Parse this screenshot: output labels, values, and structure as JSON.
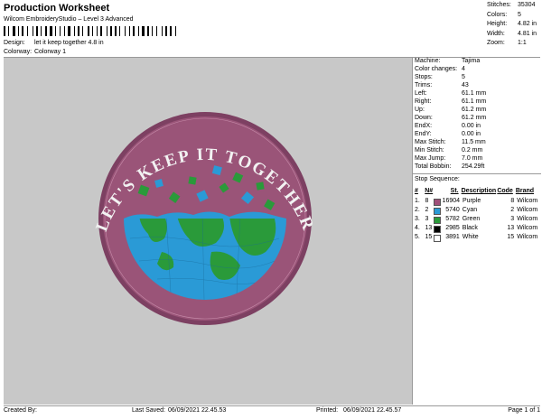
{
  "header": {
    "title": "Production Worksheet",
    "subtitle": "Wilcom EmbroideryStudio – Level 3 Advanced",
    "design_label": "Design:",
    "design_value": "let it keep together 4.8 in",
    "colorway_label": "Colorway:",
    "colorway_value": "Colorway 1"
  },
  "summary": {
    "stitches_label": "Stitches:",
    "stitches_value": "35304",
    "colors_label": "Colors:",
    "colors_value": "5",
    "height_label": "Height:",
    "height_value": "4.82 in",
    "width_label": "Width:",
    "width_value": "4.81 in",
    "zoom_label": "Zoom:",
    "zoom_value": "1:1"
  },
  "machine": {
    "machine_label": "Machine:",
    "machine_value": "Tajima",
    "color_changes_label": "Color changes:",
    "color_changes_value": "4",
    "stops_label": "Stops:",
    "stops_value": "5",
    "trims_label": "Trims:",
    "trims_value": "43",
    "left_label": "Left:",
    "left_value": "61.1 mm",
    "right_label": "Right:",
    "right_value": "61.1 mm",
    "up_label": "Up:",
    "up_value": "61.2 mm",
    "down_label": "Down:",
    "down_value": "61.2 mm",
    "endx_label": "EndX:",
    "endx_value": "0.00 in",
    "endy_label": "EndY:",
    "endy_value": "0.00 in",
    "max_stitch_label": "Max Stitch:",
    "max_stitch_value": "11.5 mm",
    "min_stitch_label": "Min Stitch:",
    "min_stitch_value": "0.2 mm",
    "max_jump_label": "Max Jump:",
    "max_jump_value": "7.0 mm",
    "total_bobbin_label": "Total Bobbin:",
    "total_bobbin_value": "254.29ft"
  },
  "stop_sequence": {
    "title": "Stop Sequence:",
    "headers": {
      "n": "#",
      "num": "N#",
      "st": "St.",
      "desc": "Description",
      "code": "Code",
      "brand": "Brand"
    },
    "rows": [
      {
        "n": "1.",
        "num": "8",
        "color": "#a0507a",
        "st": "16904",
        "desc": "Purple",
        "code": "8",
        "brand": "Wilcom"
      },
      {
        "n": "2.",
        "num": "2",
        "color": "#2a9ad6",
        "st": "5740",
        "desc": "Cyan",
        "code": "2",
        "brand": "Wilcom"
      },
      {
        "n": "3.",
        "num": "3",
        "color": "#2a9a3a",
        "st": "5782",
        "desc": "Green",
        "code": "3",
        "brand": "Wilcom"
      },
      {
        "n": "4.",
        "num": "13",
        "color": "#000000",
        "st": "2985",
        "desc": "Black",
        "code": "13",
        "brand": "Wilcom"
      },
      {
        "n": "5.",
        "num": "15",
        "color": "#ffffff",
        "st": "3891",
        "desc": "White",
        "code": "15",
        "brand": "Wilcom"
      }
    ]
  },
  "design": {
    "arc_text": "LET'S KEEP IT TOGETHER",
    "ring_color": "#8a4a6a",
    "inner_color": "#9a5478",
    "ocean_color": "#2a9ad6",
    "land_color": "#2a9a3a"
  },
  "footer": {
    "created_by_label": "Created By:",
    "last_saved_label": "Last Saved:",
    "last_saved_value": "06/09/2021 22.45.53",
    "printed_label": "Printed:",
    "printed_value": "06/09/2021 22.45.57",
    "page_label": "Page 1 of 1"
  }
}
